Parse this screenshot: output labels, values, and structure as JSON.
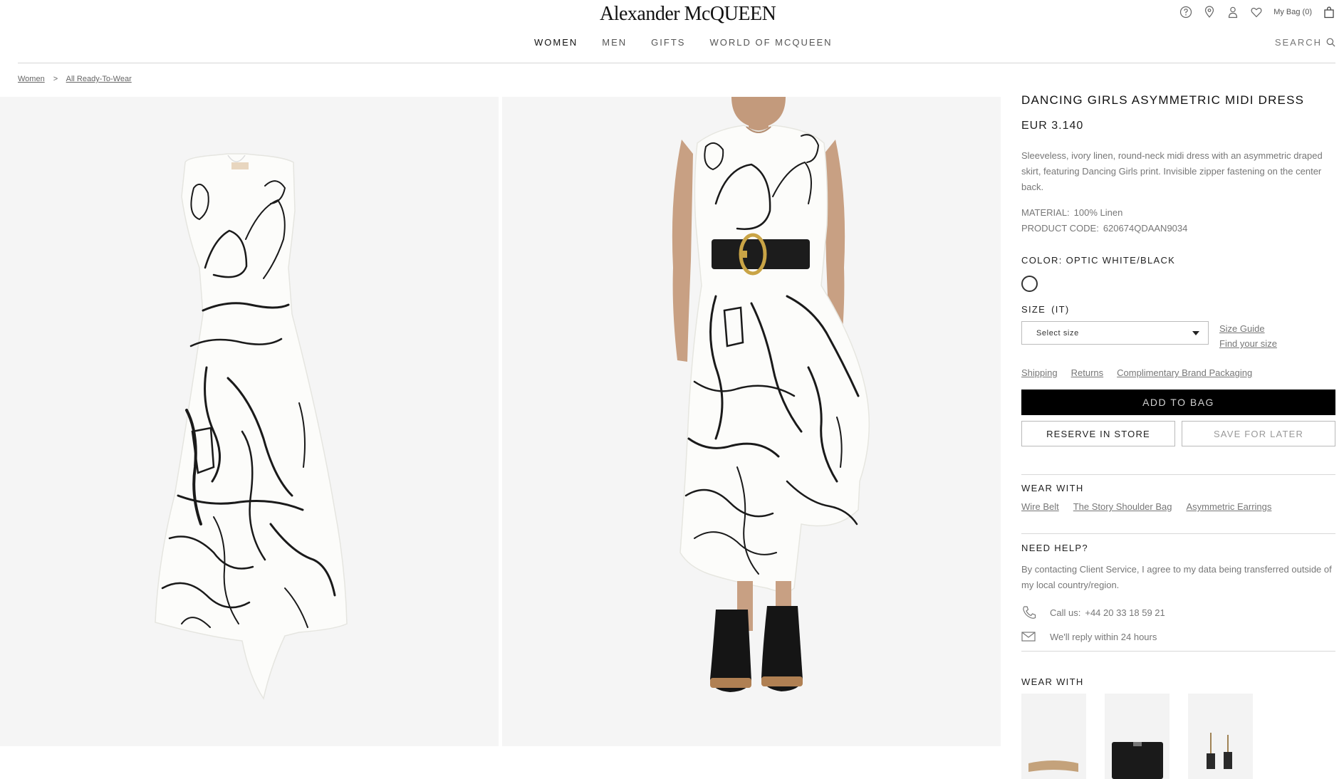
{
  "header": {
    "logo": "Alexander McQUEEN",
    "bag_label": "My Bag",
    "bag_count": "(0)",
    "search_label": "SEARCH",
    "nav": [
      {
        "label": "WOMEN",
        "active": true
      },
      {
        "label": "MEN",
        "active": false
      },
      {
        "label": "GIFTS",
        "active": false
      },
      {
        "label": "WORLD OF MCQUEEN",
        "active": false
      }
    ],
    "icons": [
      "help-icon",
      "store-locator-icon",
      "account-icon",
      "wishlist-icon",
      "bag-icon",
      "search-icon"
    ]
  },
  "breadcrumb": {
    "items": [
      "Women",
      "All Ready-To-Wear"
    ],
    "separator": ">"
  },
  "product": {
    "title": "DANCING GIRLS ASYMMETRIC MIDI DRESS",
    "price": "EUR 3.140",
    "description": "Sleeveless, ivory linen, round-neck midi dress with an asymmetric draped skirt, featuring Dancing Girls print. Invisible zipper fastening on the center back.",
    "material_label": "MATERIAL:",
    "material": "100% Linen",
    "code_label": "PRODUCT CODE:",
    "code": "620674QDAAN9034",
    "color_label": "COLOR:",
    "color": "OPTIC WHITE/BLACK",
    "size_label": "SIZE",
    "size_unit": "(IT)",
    "size_placeholder": "Select size",
    "size_guide": "Size Guide",
    "find_size": "Find your size",
    "policy_links": [
      "Shipping",
      "Returns",
      "Complimentary Brand Packaging"
    ],
    "add_to_bag": "ADD TO BAG",
    "reserve": "RESERVE IN STORE",
    "save_later": "SAVE FOR LATER"
  },
  "wear_with": {
    "label": "WEAR WITH",
    "links": [
      "Wire Belt",
      "The Story Shoulder Bag",
      "Asymmetric Earrings"
    ]
  },
  "help": {
    "label": "NEED HELP?",
    "text": "By contacting Client Service, I agree to my data being transferred outside of my local country/region.",
    "call_label": "Call us:",
    "phone": "+44 20 33 18 59 21",
    "reply": "We'll reply within 24 hours"
  },
  "wear_with_2": {
    "label": "WEAR WITH"
  },
  "colors": {
    "text": "#1b1b1b",
    "muted": "#777777",
    "image_bg": "#f5f5f5",
    "button": "#000000",
    "divider": "#d8d8d8"
  }
}
